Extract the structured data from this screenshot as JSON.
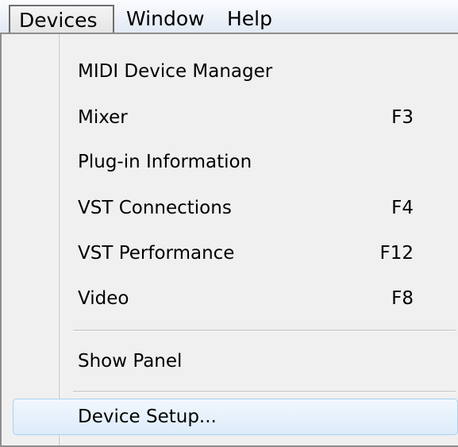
{
  "menubar": {
    "items": [
      {
        "label": "Devices"
      },
      {
        "label": "Window"
      },
      {
        "label": "Help"
      }
    ]
  },
  "devices_menu": {
    "items": [
      {
        "label": "MIDI Device Manager",
        "shortcut": ""
      },
      {
        "label": "Mixer",
        "shortcut": "F3"
      },
      {
        "label": "Plug-in Information",
        "shortcut": ""
      },
      {
        "label": "VST Connections",
        "shortcut": "F4"
      },
      {
        "label": "VST Performance",
        "shortcut": "F12"
      },
      {
        "label": "Video",
        "shortcut": "F8"
      }
    ],
    "show_panel": {
      "label": "Show Panel"
    },
    "device_setup": {
      "label": "Device Setup..."
    }
  },
  "colors": {
    "highlight_border": "#a9d0ec",
    "highlight_fill": "#ddecfa",
    "menu_background": "#f0f0f0"
  }
}
